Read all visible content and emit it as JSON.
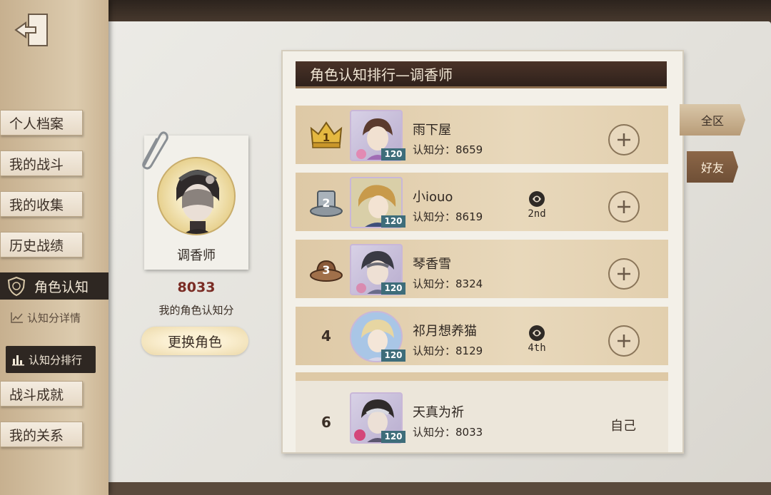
{
  "sidebar": {
    "items": [
      {
        "label": "个人档案"
      },
      {
        "label": "我的战斗"
      },
      {
        "label": "我的收集"
      },
      {
        "label": "历史战绩"
      },
      {
        "label": "角色认知"
      },
      {
        "label": "战斗成就"
      },
      {
        "label": "我的关系"
      }
    ],
    "sub_items": [
      {
        "label": "认知分详情"
      },
      {
        "label": "认知分排行"
      }
    ]
  },
  "profile": {
    "character_name": "调香师",
    "score": "8033",
    "score_label": "我的角色认知分",
    "change_button": "更换角色"
  },
  "ranking": {
    "title": "角色认知排行—调香师",
    "rows": [
      {
        "rank": "1",
        "name": "雨下屋",
        "score": "认知分：8659",
        "level": "120",
        "badge": ""
      },
      {
        "rank": "2",
        "name": "小iouo",
        "score": "认知分：8619",
        "level": "120",
        "badge": "2nd"
      },
      {
        "rank": "3",
        "name": "琴香雪",
        "score": "认知分：8324",
        "level": "120",
        "badge": ""
      },
      {
        "rank": "4",
        "name": "祁月想养猫",
        "score": "认知分：8129",
        "level": "120",
        "badge": "4th"
      }
    ],
    "self_row": {
      "rank": "6",
      "name": "天真为祈",
      "score": "认知分：8033",
      "level": "120",
      "label": "自己"
    }
  },
  "tabs": {
    "all": "全区",
    "friends": "好友"
  }
}
